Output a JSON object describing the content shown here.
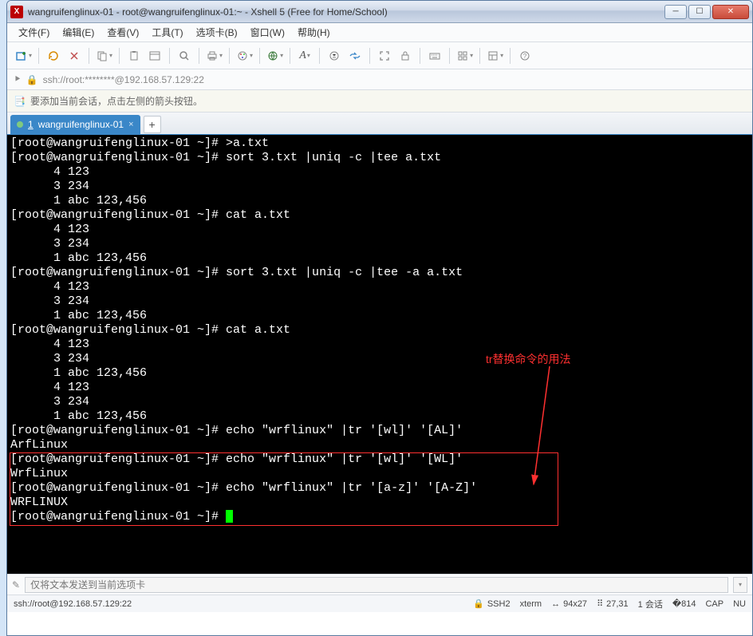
{
  "window": {
    "title": "wangruifenglinux-01 - root@wangruifenglinux-01:~ - Xshell 5 (Free for Home/School)"
  },
  "menu": {
    "file": "文件(F)",
    "edit": "编辑(E)",
    "view": "查看(V)",
    "tools": "工具(T)",
    "tabs": "选项卡(B)",
    "window": "窗口(W)",
    "help": "帮助(H)"
  },
  "address": {
    "text": "ssh://root:********@192.168.57.129:22"
  },
  "hint": {
    "text": "要添加当前会话，点击左侧的箭头按钮。"
  },
  "tab": {
    "index": "1",
    "label": "wangruifenglinux-01"
  },
  "annotation": {
    "text": "tr替换命令的用法"
  },
  "terminal": {
    "prompt": "[root@wangruifenglinux-01 ~]#",
    "lines": [
      "[root@wangruifenglinux-01 ~]# >a.txt",
      "[root@wangruifenglinux-01 ~]# sort 3.txt |uniq -c |tee a.txt",
      "      4 123",
      "      3 234",
      "      1 abc 123,456",
      "[root@wangruifenglinux-01 ~]# cat a.txt",
      "      4 123",
      "      3 234",
      "      1 abc 123,456",
      "[root@wangruifenglinux-01 ~]# sort 3.txt |uniq -c |tee -a a.txt",
      "      4 123",
      "      3 234",
      "      1 abc 123,456",
      "[root@wangruifenglinux-01 ~]# cat a.txt",
      "      4 123",
      "      3 234",
      "      1 abc 123,456",
      "      4 123",
      "      3 234",
      "      1 abc 123,456",
      "[root@wangruifenglinux-01 ~]# echo \"wrflinux\" |tr '[wl]' '[AL]'",
      "ArfLinux",
      "[root@wangruifenglinux-01 ~]# echo \"wrflinux\" |tr '[wl]' '[WL]'",
      "WrfLinux",
      "[root@wangruifenglinux-01 ~]# echo \"wrflinux\" |tr '[a-z]' '[A-Z]'",
      "WRFLINUX",
      "[root@wangruifenglinux-01 ~]# "
    ]
  },
  "input": {
    "placeholder": "仅将文本发送到当前选项卡"
  },
  "status": {
    "connection": "ssh://root@192.168.57.129:22",
    "protocol": "SSH2",
    "term": "xterm",
    "size": "94x27",
    "pos": "27,31",
    "sessions": "1 会话",
    "cap": "CAP",
    "num": "NU"
  },
  "colors": {
    "tab_active": "#3a87c8",
    "annotation": "#ff3030",
    "cursor": "#00ff00"
  }
}
